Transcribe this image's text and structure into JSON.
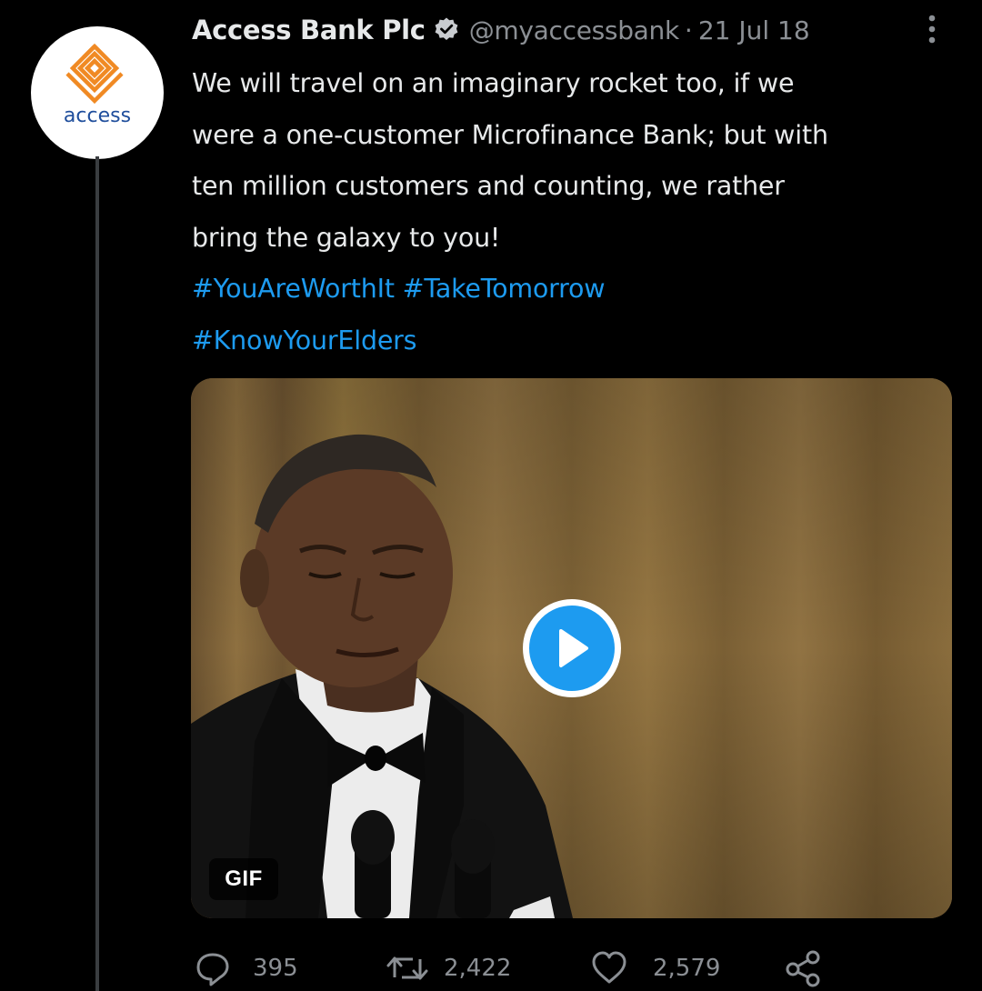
{
  "account": {
    "display_name": "Access Bank Plc",
    "handle": "@myaccessbank",
    "separator": "·",
    "date": "21 Jul 18",
    "verified": true,
    "avatar_logo_text": "access",
    "brand_color": "#f08a24",
    "brand_text_color": "#1f4e9c"
  },
  "tweet": {
    "lines": [
      "We will travel on an imaginary rocket too, if we",
      "were a one-customer Microfinance Bank; but with",
      "ten million customers and counting, we rather",
      "bring the galaxy to you!"
    ],
    "hashtags_line1": "#YouAreWorthIt #TakeTomorrow",
    "hashtags_line2": "#KnowYourElders"
  },
  "media": {
    "type_badge": "GIF",
    "play_icon": "play-icon"
  },
  "actions": {
    "replies": "395",
    "retweets": "2,422",
    "likes": "2,579",
    "reply_icon": "reply-icon",
    "retweet_icon": "retweet-icon",
    "like_icon": "heart-icon",
    "share_icon": "share-icon"
  },
  "colors": {
    "background": "#000000",
    "text": "#e7e9ea",
    "muted": "#8b8f94",
    "link": "#1d9bf0"
  }
}
